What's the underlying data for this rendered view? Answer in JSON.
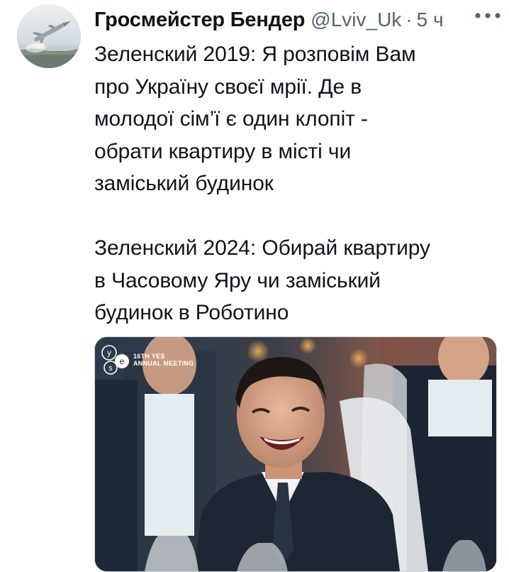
{
  "tweet": {
    "display_name": "Гросмейстер Бендер",
    "handle": "@Lviv_Uk",
    "separator": "·",
    "time": "5 ч",
    "more_icon": "more-horizontal-icon",
    "text": "Зеленский 2019: Я розповім Вам\nпро Україну своєї мрії. Де в\nмолодої сім’ї є один клопіт -\nобрати квартиру в місті чи\nзаміський будинок\n\nЗеленский 2024: Обирай квартиру\nв Часовому Яру чи заміський\nбудинок в Роботино"
  },
  "media": {
    "event_label_line1": "16TH YES",
    "event_label_line2": "ANNUAL MEETING",
    "logo_letters": [
      "y",
      "e",
      "s"
    ]
  },
  "colors": {
    "text_primary": "#0f1419",
    "text_secondary": "#536471",
    "media_border": "#cfd9de"
  }
}
